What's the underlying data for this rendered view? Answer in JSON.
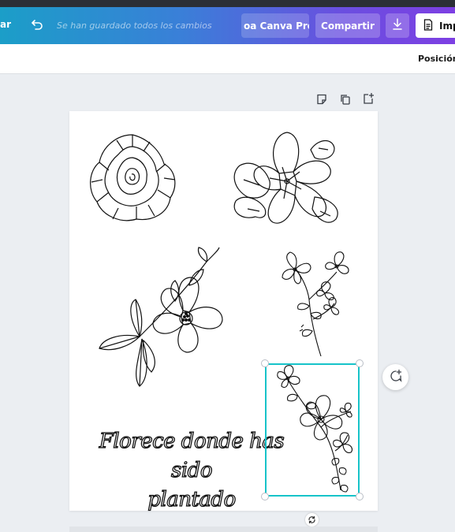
{
  "toolbar": {
    "left_label": "ar",
    "saved_status": "Se han guardado todos los cambios",
    "pro_button": "oa Canva Pro",
    "share_button": "Compartir",
    "print_button": "Imp"
  },
  "subbar": {
    "position_label": "Posición"
  },
  "canvas": {
    "quote_line1": "Florece donde has sido",
    "quote_line2": "plantado"
  },
  "icons": {
    "undo": "undo-icon",
    "download": "download-icon",
    "print": "document-icon",
    "page_note": "note-icon",
    "page_duplicate": "duplicate-icon",
    "page_add": "add-page-icon",
    "rotate": "rotate-icon",
    "comment": "comment-add-icon"
  },
  "colors": {
    "selection": "#17c3c9",
    "toolbar_start": "#1b9ec8",
    "toolbar_end": "#7d3fe3"
  }
}
